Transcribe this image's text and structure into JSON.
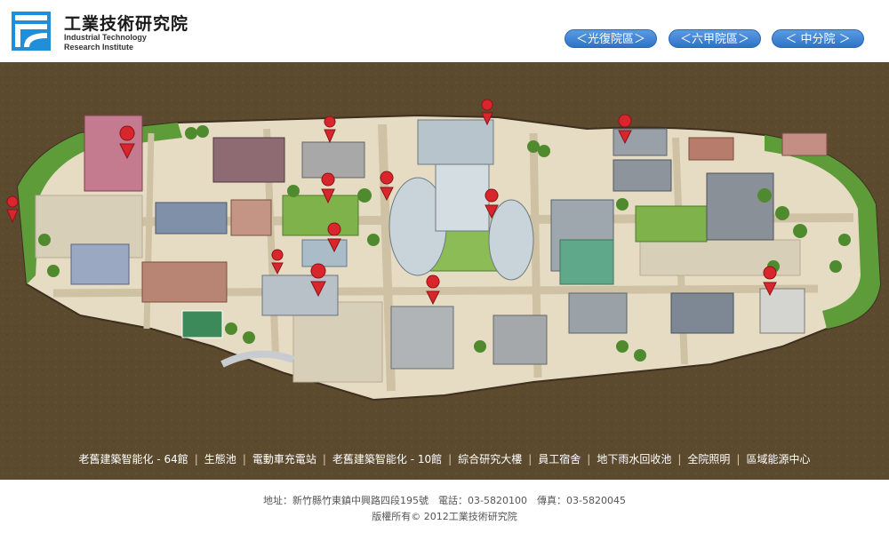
{
  "header": {
    "logo_cn": "工業技術研究院",
    "logo_en_line1": "Industrial Technology",
    "logo_en_line2": "Research Institute"
  },
  "campus_tabs": [
    {
      "label": "＜光復院區＞"
    },
    {
      "label": "＜六甲院區＞"
    },
    {
      "label": "＜ 中分院 ＞"
    }
  ],
  "nav_items": [
    {
      "label": "老舊建築智能化 - 64館"
    },
    {
      "label": "生態池"
    },
    {
      "label": "電動車充電站"
    },
    {
      "label": "老舊建築智能化 - 10館"
    },
    {
      "label": "綜合研究大樓"
    },
    {
      "label": "員工宿舍"
    },
    {
      "label": "地下雨水回收池"
    },
    {
      "label": "全院照明"
    },
    {
      "label": "區域能源中心"
    }
  ],
  "nav_separator": "|",
  "footer": {
    "address": "地址：新竹縣竹東鎮中興路四段195號　電話：03-5820100　傳真：03-5820045",
    "copyright": "版權所有© 2012工業技術研究院"
  },
  "colors": {
    "map_background": "#5c4a2f",
    "campus_ground": "#e6dcc4",
    "tab_blue": "#3a80d2",
    "marker_red": "#d9262c"
  },
  "icons": {
    "map_marker": "map-pin-icon",
    "logo": "itri-logo-icon"
  }
}
